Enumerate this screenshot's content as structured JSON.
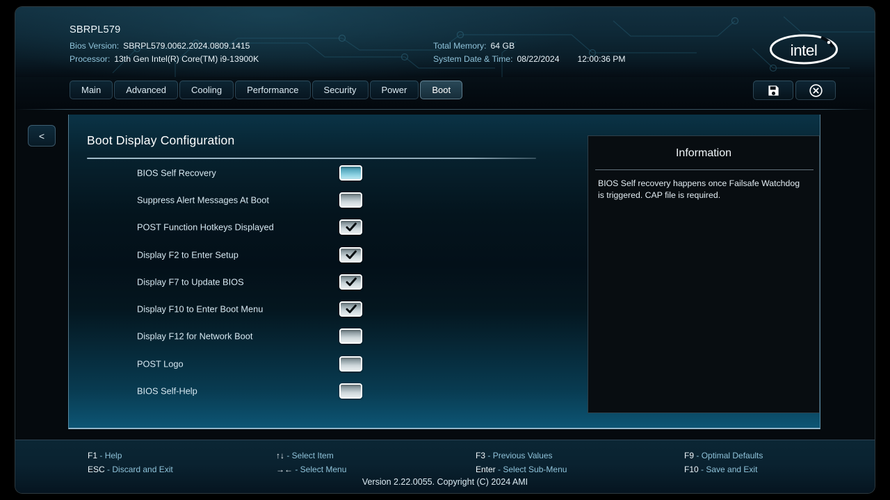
{
  "header": {
    "board_name": "SBRPL579",
    "bios_version_label": "Bios Version:",
    "bios_version_value": "SBRPL579.0062.2024.0809.1415",
    "processor_label": "Processor:",
    "processor_value": "13th Gen Intel(R) Core(TM) i9-13900K",
    "memory_label": "Total Memory:",
    "memory_value": "64 GB",
    "datetime_label": "System Date & Time:",
    "date_value": "08/22/2024",
    "time_value": "12:00:36 PM",
    "logo_text": "intel"
  },
  "tabs": [
    {
      "label": "Main",
      "active": false
    },
    {
      "label": "Advanced",
      "active": false
    },
    {
      "label": "Cooling",
      "active": false
    },
    {
      "label": "Performance",
      "active": false
    },
    {
      "label": "Security",
      "active": false
    },
    {
      "label": "Power",
      "active": false
    },
    {
      "label": "Boot",
      "active": true
    }
  ],
  "tab_actions": {
    "save_icon": "save-disk-icon",
    "close_icon": "close-circle-icon"
  },
  "back_button": {
    "label": "<"
  },
  "panel": {
    "title": "Boot Display Configuration",
    "settings": [
      {
        "label": "BIOS Self Recovery",
        "checked": false,
        "highlighted": true
      },
      {
        "label": "Suppress Alert Messages At Boot",
        "checked": false,
        "highlighted": false
      },
      {
        "label": "POST Function Hotkeys Displayed",
        "checked": true,
        "highlighted": false
      },
      {
        "label": "Display F2 to Enter Setup",
        "checked": true,
        "highlighted": false
      },
      {
        "label": "Display F7 to Update BIOS",
        "checked": true,
        "highlighted": false
      },
      {
        "label": "Display F10 to Enter Boot Menu",
        "checked": true,
        "highlighted": false
      },
      {
        "label": "Display F12 for Network Boot",
        "checked": false,
        "highlighted": false
      },
      {
        "label": "POST Logo",
        "checked": false,
        "highlighted": false
      },
      {
        "label": "BIOS Self-Help",
        "checked": false,
        "highlighted": false
      }
    ]
  },
  "info": {
    "title": "Information",
    "body": "BIOS Self recovery happens once Failsafe Watchdog is triggered. CAP file is required."
  },
  "footer": {
    "columns": [
      [
        {
          "key": "F1",
          "desc": "- Help"
        },
        {
          "key": "ESC",
          "desc": "- Discard and Exit"
        }
      ],
      [
        {
          "key": "↑↓",
          "desc": "- Select Item"
        },
        {
          "key": "→←",
          "desc": "- Select Menu"
        }
      ],
      [
        {
          "key": "F3",
          "desc": "- Previous Values"
        },
        {
          "key": "Enter",
          "desc": "- Select Sub-Menu"
        }
      ],
      [
        {
          "key": "F9",
          "desc": "- Optimal Defaults"
        },
        {
          "key": "F10",
          "desc": "- Save and Exit"
        }
      ]
    ],
    "version": "Version 2.22.0055. Copyright (C) 2024 AMI"
  },
  "colors": {
    "accent_cyan": "#8fd3e3",
    "label_blue": "#8fc3da",
    "text_white": "#eef6fa",
    "panel_bottom": "#0d5574"
  }
}
